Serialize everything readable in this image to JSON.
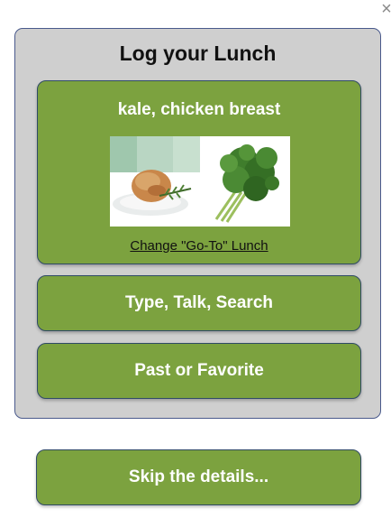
{
  "dialog": {
    "close_glyph": "×",
    "title": "Log your Lunch",
    "goto_lunch": {
      "foods": "kale, chicken breast",
      "change_link": "Change \"Go-To\" Lunch",
      "images": [
        "chicken-breast-photo",
        "kale-photo"
      ]
    },
    "type_talk_search": "Type, Talk, Search",
    "past_or_favorite": "Past or Favorite",
    "skip": "Skip the details..."
  },
  "colors": {
    "button_green": "#7ca23f",
    "panel_gray": "#cfcfcf",
    "border_navy": "#2f4a66"
  }
}
